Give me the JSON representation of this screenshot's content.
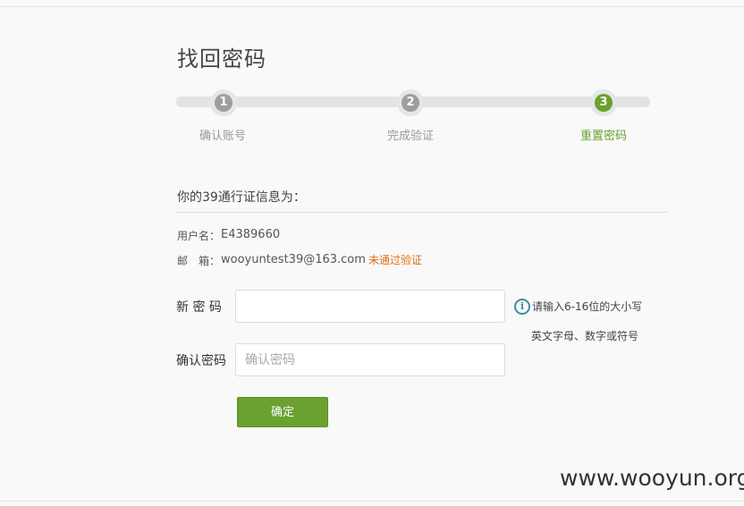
{
  "page": {
    "title": "找回密码"
  },
  "steps": [
    {
      "number": "1",
      "label": "确认账号",
      "active": false
    },
    {
      "number": "2",
      "label": "完成验证",
      "active": false
    },
    {
      "number": "3",
      "label": "重置密码",
      "active": true
    }
  ],
  "account_info": {
    "heading": "你的39通行证信息为：",
    "username_label": "用户名：",
    "username_value": "E4389660",
    "email_label": "邮　箱：",
    "email_value": "wooyuntest39@163.com",
    "email_status": "未通过验证"
  },
  "form": {
    "new_password_label": "新 密 码",
    "new_password_value": "",
    "new_password_placeholder": "",
    "confirm_password_label": "确认密码",
    "confirm_password_placeholder": "确认密码",
    "hint_line1": "请输入6-16位的大小写",
    "hint_line2": "英文字母、数字或符号",
    "submit_label": "确定"
  },
  "watermark": "www.wooyun.org",
  "colors": {
    "accent": "#6aa130",
    "warning": "#e0700f",
    "inactive_step": "#9e9e9e",
    "info_icon": "#3d8fa6"
  },
  "icons": {
    "hint": "info-circle-icon"
  }
}
